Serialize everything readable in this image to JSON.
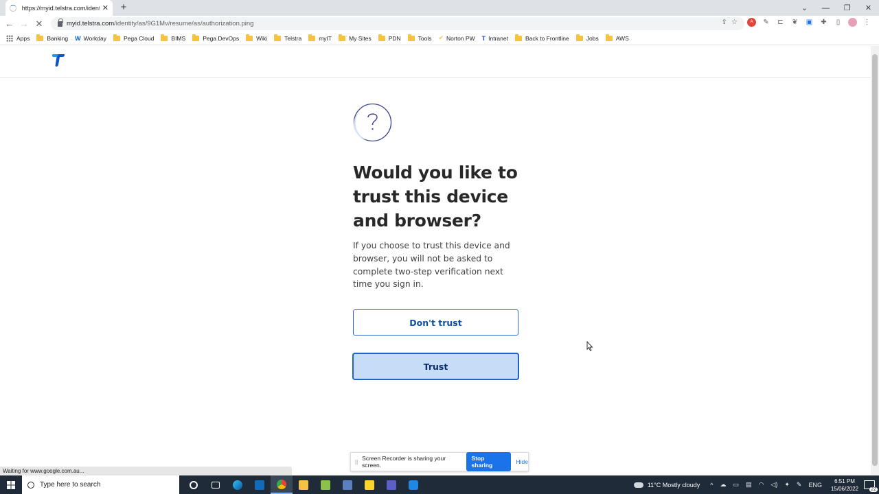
{
  "browser": {
    "tab_title": "https://myid.telstra.com/identity",
    "url_host": "myid.telstra.com",
    "url_path": "/identity/as/9G1Mv/resume/as/authorization.ping",
    "status_text": "Waiting for www.google.com.au..."
  },
  "bookmarks": [
    {
      "label": "Apps",
      "icon": "apps-grid-icon"
    },
    {
      "label": "Banking",
      "icon": "folder-icon"
    },
    {
      "label": "Workday",
      "icon": "workday-icon"
    },
    {
      "label": "Pega Cloud",
      "icon": "folder-icon"
    },
    {
      "label": "BIMS",
      "icon": "folder-icon"
    },
    {
      "label": "Pega DevOps",
      "icon": "folder-icon"
    },
    {
      "label": "Wiki",
      "icon": "folder-icon"
    },
    {
      "label": "Telstra",
      "icon": "folder-icon"
    },
    {
      "label": "myIT",
      "icon": "folder-icon"
    },
    {
      "label": "My Sites",
      "icon": "folder-icon"
    },
    {
      "label": "PDN",
      "icon": "folder-icon"
    },
    {
      "label": "Tools",
      "icon": "folder-icon"
    },
    {
      "label": "Norton PW",
      "icon": "norton-check-icon"
    },
    {
      "label": "Intranet",
      "icon": "telstra-icon"
    },
    {
      "label": "Back to Frontline",
      "icon": "folder-icon"
    },
    {
      "label": "Jobs",
      "icon": "folder-icon"
    },
    {
      "label": "AWS",
      "icon": "folder-icon"
    }
  ],
  "page": {
    "heading": "Would you like to trust this device and browser?",
    "description": "If you choose to trust this device and browser, you will not be asked to complete two-step verification next time you sign in.",
    "dont_trust_label": "Don't trust",
    "trust_label": "Trust"
  },
  "share_bar": {
    "message": "Screen Recorder is sharing your screen.",
    "stop_label": "Stop sharing",
    "hide_label": "Hide"
  },
  "taskbar": {
    "search_placeholder": "Type here to search",
    "weather": "11°C  Mostly cloudy",
    "language": "ENG",
    "time": "6:51 PM",
    "date": "15/06/2022",
    "notification_count": "22"
  },
  "colors": {
    "trust_fill": "#c7ddf7",
    "trust_border": "#1d63c9",
    "link_blue": "#0d4fa8",
    "taskbar": "#1f2b38"
  }
}
